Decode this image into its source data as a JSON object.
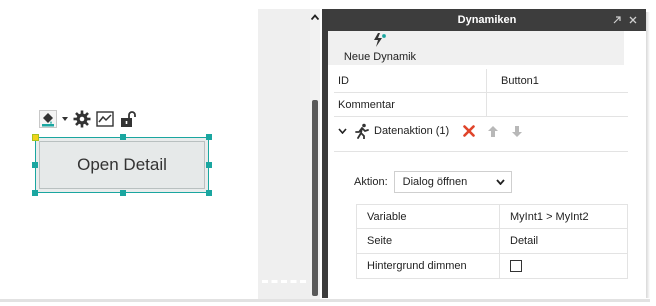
{
  "canvas": {
    "widget_label": "Open Detail",
    "toolbar_icons": [
      "paint-bucket-icon",
      "gear-icon",
      "chart-icon",
      "unlock-icon"
    ]
  },
  "panel": {
    "title": "Dynamiken",
    "new_dynamic_label": "Neue Dynamik",
    "properties": [
      {
        "key": "ID",
        "value": "Button1"
      },
      {
        "key": "Kommentar",
        "value": ""
      }
    ],
    "action": {
      "header_label": "Datenaktion (1)",
      "aktion_label": "Aktion:",
      "aktion_value": "Dialog öffnen",
      "rows": [
        {
          "key": "Variable",
          "value": "MyInt1 > MyInt2"
        },
        {
          "key": "Seite",
          "value": "Detail"
        },
        {
          "key": "Hintergrund dimmen",
          "value": ""
        }
      ],
      "hintergrund_checked": false
    }
  },
  "colors": {
    "title_bar": "#3d3d3d",
    "selection": "#1aa6a0",
    "delete": "#e0442a"
  }
}
